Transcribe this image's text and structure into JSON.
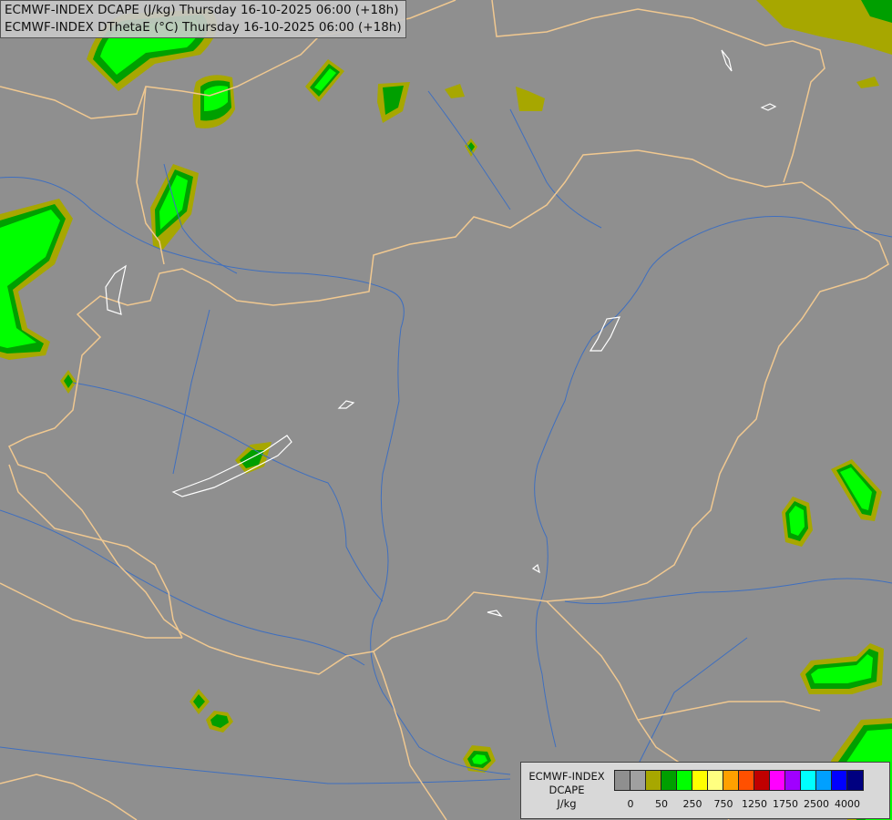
{
  "title": {
    "line1": "ECMWF-INDEX DCAPE (J/kg) Thursday 16-10-2025 06:00 (+18h)",
    "line2": "ECMWF-INDEX DThetaE (°C) Thursday 16-10-2025 06:00 (+18h)"
  },
  "legend": {
    "line1": "ECMWF-INDEX",
    "line2": "DCAPE",
    "line3": "J/kg",
    "colors": [
      "#8f8f8f",
      "#a0a0a0",
      "#a7a700",
      "#009f00",
      "#00ff00",
      "#ffff00",
      "#ffff80",
      "#ffa000",
      "#ff5000",
      "#c00000",
      "#ff00ff",
      "#a000ff",
      "#00ffff",
      "#00a0ff",
      "#0000ff",
      "#000080"
    ],
    "ticks": [
      "0",
      "50",
      "250",
      "750",
      "1250",
      "1750",
      "2500",
      "4000"
    ]
  },
  "colors": {
    "background": "#8f8f8f",
    "border": "#f0c890",
    "river": "#3f6fbf",
    "lake": "#ffffff",
    "olive": "#a7a700",
    "dark_green": "#009f00",
    "bright_green": "#00ff00"
  }
}
